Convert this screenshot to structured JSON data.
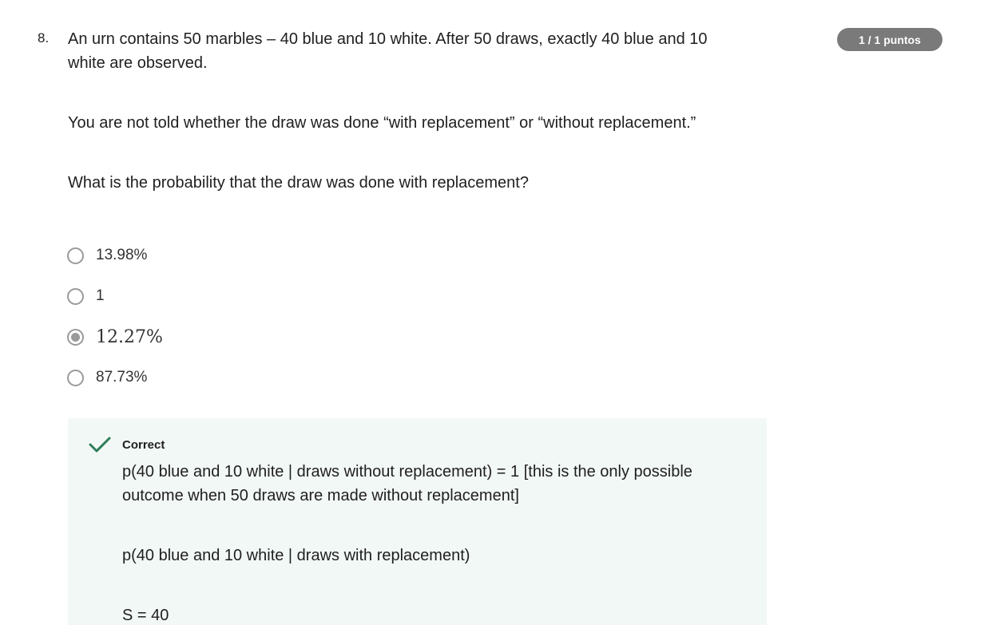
{
  "question": {
    "number": "8.",
    "paragraphs": [
      "An urn contains 50 marbles – 40 blue and 10 white. After 50 draws, exactly 40 blue and 10 white are observed.",
      "You are not told whether the draw was done “with replacement” or “without replacement.”",
      "What is the probability that the draw was done with replacement?"
    ]
  },
  "score": {
    "label": "1 / 1 puntos"
  },
  "options": [
    {
      "label": "13.98%",
      "selected": false
    },
    {
      "label": "1",
      "selected": false
    },
    {
      "label": "12.27%",
      "selected": true
    },
    {
      "label": "87.73%",
      "selected": false
    }
  ],
  "feedback": {
    "status": "Correct",
    "check_icon": "check-icon",
    "color": "#2e7d5b",
    "lines": [
      "p(40 blue and 10 white | draws without replacement) = 1 [this is the only possible outcome when 50 draws are made without replacement]",
      "p(40 blue and 10 white | draws with replacement)",
      "S = 40"
    ]
  }
}
